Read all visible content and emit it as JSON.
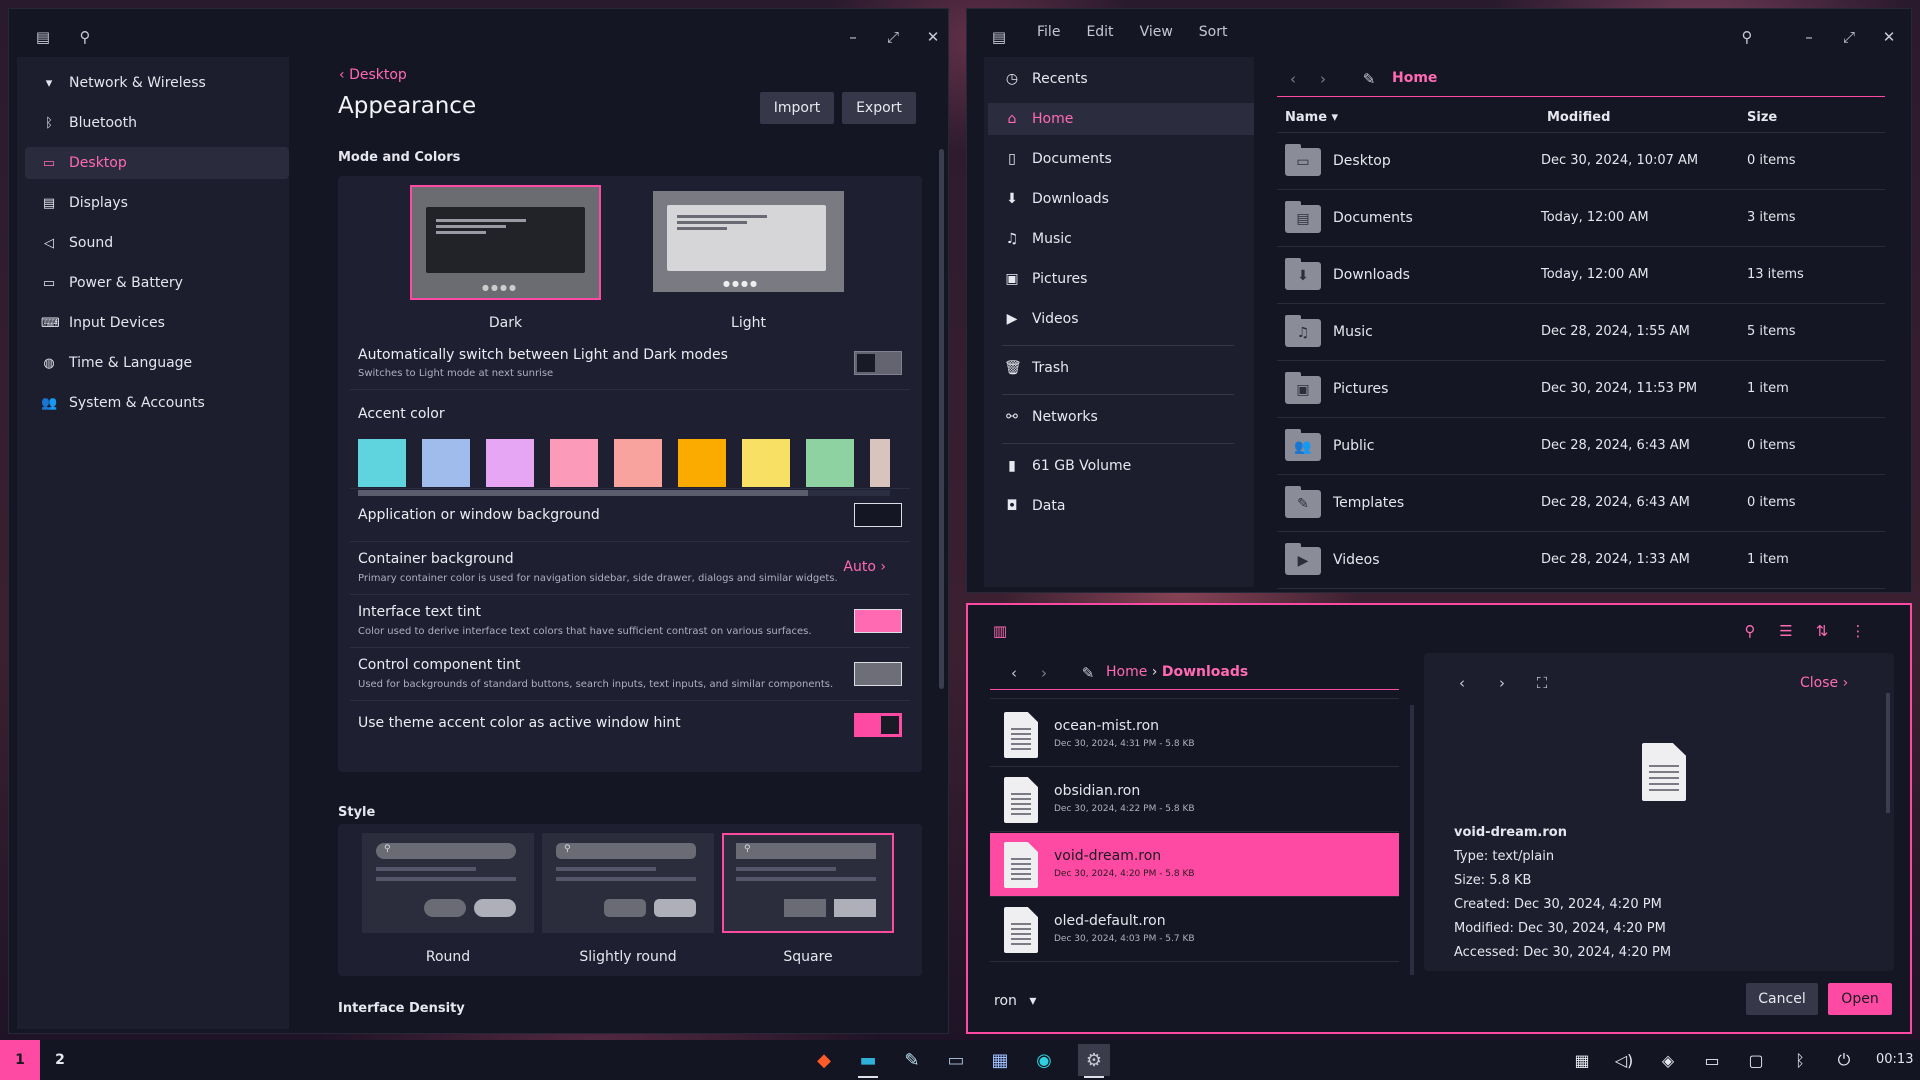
{
  "colors": {
    "accent": "#ff4aa3",
    "window_bg": "#151624",
    "panel_bg": "#1e2032"
  },
  "settings": {
    "nav": [
      {
        "label": "Network & Wireless",
        "icon": "wifi-icon"
      },
      {
        "label": "Bluetooth",
        "icon": "bluetooth-icon"
      },
      {
        "label": "Desktop",
        "icon": "monitor-icon",
        "selected": true
      },
      {
        "label": "Displays",
        "icon": "display-icon"
      },
      {
        "label": "Sound",
        "icon": "speaker-icon"
      },
      {
        "label": "Power & Battery",
        "icon": "battery-icon"
      },
      {
        "label": "Input Devices",
        "icon": "keyboard-icon"
      },
      {
        "label": "Time & Language",
        "icon": "globe-icon"
      },
      {
        "label": "System & Accounts",
        "icon": "users-icon"
      }
    ],
    "breadcrumb": "Desktop",
    "title": "Appearance",
    "import_label": "Import",
    "export_label": "Export",
    "mode_section": "Mode and Colors",
    "mode_dark": "Dark",
    "mode_light": "Light",
    "auto_switch": {
      "title": "Automatically switch between Light and Dark modes",
      "sub": "Switches to Light mode at next sunrise",
      "value": false
    },
    "accent_title": "Accent color",
    "accent_colors": [
      "#5fd3de",
      "#9fbcec",
      "#e6a6f3",
      "#fb9ab9",
      "#f9a39e",
      "#fbaa00",
      "#f8e064",
      "#8ed2a1",
      "#d8c4bc"
    ],
    "app_bg": {
      "title": "Application or window background",
      "color": "#151624"
    },
    "container_bg": {
      "title": "Container background",
      "sub": "Primary container color is used for navigation sidebar, side drawer, dialogs and similar widgets.",
      "value": "Auto"
    },
    "text_tint": {
      "title": "Interface text tint",
      "sub": "Color used to derive interface text colors that have sufficient contrast on various surfaces.",
      "color": "#ff6ab3"
    },
    "control_tint": {
      "title": "Control component tint",
      "sub": "Used for backgrounds of standard buttons, search inputs, text inputs, and similar components.",
      "color": "#6d6e78"
    },
    "window_hint": {
      "title": "Use theme accent color as active window hint",
      "value": true
    },
    "style_section": "Style",
    "styles": [
      "Round",
      "Slightly round",
      "Square"
    ],
    "density_section": "Interface Density"
  },
  "files": {
    "menu": [
      "File",
      "Edit",
      "View",
      "Sort"
    ],
    "places": [
      {
        "label": "Recents",
        "icon": "clock-icon"
      },
      {
        "label": "Home",
        "icon": "home-icon",
        "selected": true
      },
      {
        "label": "Documents",
        "icon": "document-icon"
      },
      {
        "label": "Downloads",
        "icon": "download-icon"
      },
      {
        "label": "Music",
        "icon": "music-icon"
      },
      {
        "label": "Pictures",
        "icon": "picture-icon"
      },
      {
        "label": "Videos",
        "icon": "video-icon"
      },
      {
        "label": "Trash",
        "icon": "trash-icon"
      },
      {
        "label": "Networks",
        "icon": "network-icon"
      },
      {
        "label": "61 GB Volume",
        "icon": "drive-icon"
      },
      {
        "label": "Data",
        "icon": "disk-icon"
      }
    ],
    "location": "Home",
    "columns": {
      "name": "Name",
      "modified": "Modified",
      "size": "Size"
    },
    "rows": [
      {
        "name": "Desktop",
        "modified": "Dec 30, 2024, 10:07 AM",
        "size": "0 items",
        "glyph": "▭"
      },
      {
        "name": "Documents",
        "modified": "Today, 12:00 AM",
        "size": "3 items",
        "glyph": "▤"
      },
      {
        "name": "Downloads",
        "modified": "Today, 12:00 AM",
        "size": "13 items",
        "glyph": "⬇"
      },
      {
        "name": "Music",
        "modified": "Dec 28, 2024, 1:55 AM",
        "size": "5 items",
        "glyph": "♫"
      },
      {
        "name": "Pictures",
        "modified": "Dec 30, 2024, 11:53 PM",
        "size": "1 item",
        "glyph": "▣"
      },
      {
        "name": "Public",
        "modified": "Dec 28, 2024, 6:43 AM",
        "size": "0 items",
        "glyph": "👥"
      },
      {
        "name": "Templates",
        "modified": "Dec 28, 2024, 6:43 AM",
        "size": "0 items",
        "glyph": "✎"
      },
      {
        "name": "Videos",
        "modified": "Dec 28, 2024, 1:33 AM",
        "size": "1 item",
        "glyph": "▶"
      }
    ]
  },
  "dialog": {
    "crumbs": [
      "Home",
      "Downloads"
    ],
    "files": [
      {
        "name": "ocean-mist.ron",
        "meta": "Dec 30, 2024, 4:31 PM - 5.8 KB"
      },
      {
        "name": "obsidian.ron",
        "meta": "Dec 30, 2024, 4:22 PM - 5.8 KB"
      },
      {
        "name": "void-dream.ron",
        "meta": "Dec 30, 2024, 4:20 PM - 5.8 KB",
        "selected": true
      },
      {
        "name": "oled-default.ron",
        "meta": "Dec 30, 2024, 4:03 PM - 5.7 KB"
      }
    ],
    "close_label": "Close",
    "preview": {
      "name": "void-dream.ron",
      "type": "Type: text/plain",
      "size": "Size: 5.8 KB",
      "created": "Created: Dec 30, 2024, 4:20 PM",
      "modified": "Modified: Dec 30, 2024, 4:20 PM",
      "accessed": "Accessed: Dec 30, 2024, 4:20 PM"
    },
    "filter": "ron",
    "cancel_label": "Cancel",
    "open_label": "Open"
  },
  "taskbar": {
    "workspaces": [
      "1",
      "2"
    ],
    "clock": "00:13"
  }
}
